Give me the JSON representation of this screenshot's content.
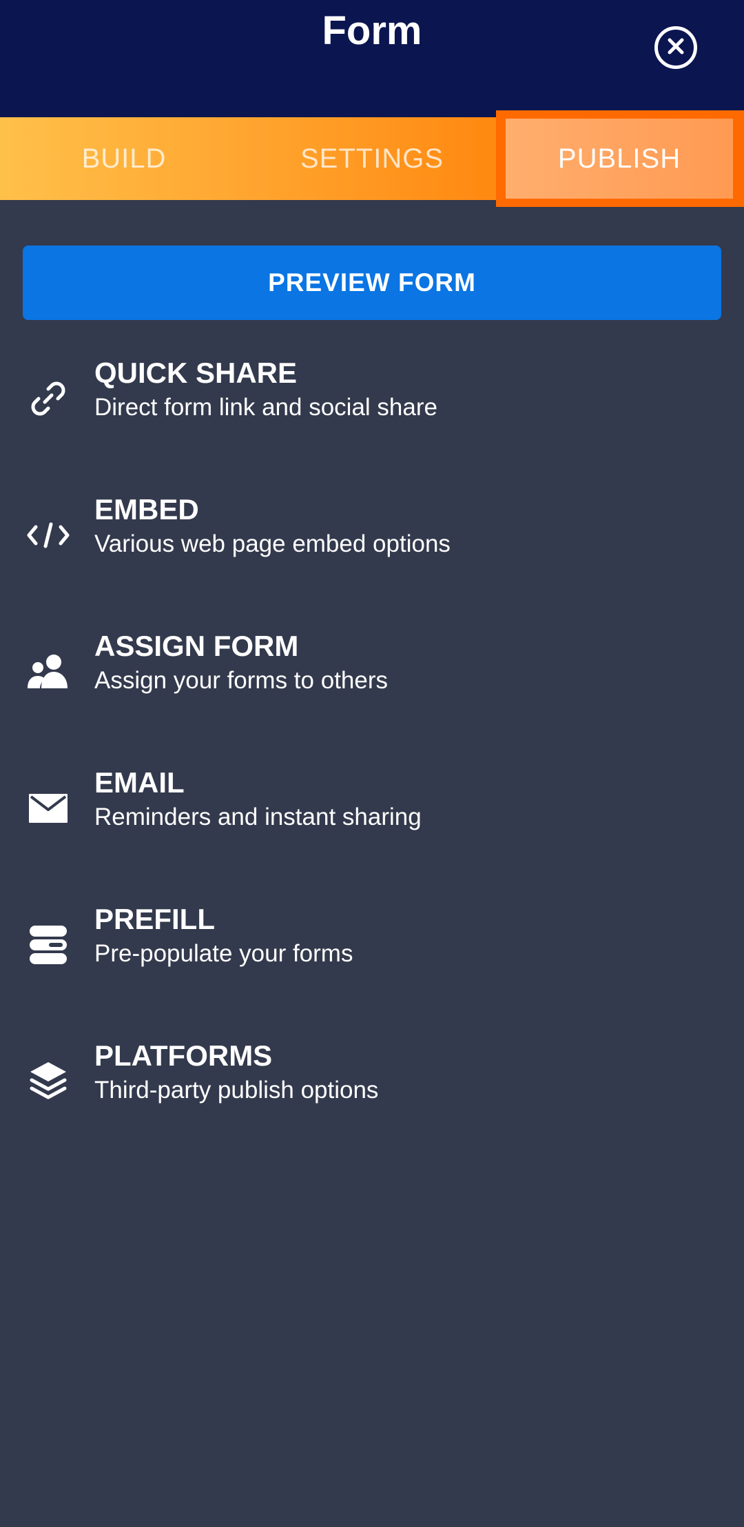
{
  "header": {
    "title": "Form",
    "close_icon": "close-circle-icon"
  },
  "tabs": [
    {
      "label": "BUILD",
      "active": false
    },
    {
      "label": "SETTINGS",
      "active": false
    },
    {
      "label": "PUBLISH",
      "active": true
    }
  ],
  "preview_button": {
    "label": "PREVIEW FORM"
  },
  "items": [
    {
      "title": "QUICK SHARE",
      "subtitle": "Direct form link and social share",
      "icon": "link-icon"
    },
    {
      "title": "EMBED",
      "subtitle": "Various web page embed options",
      "icon": "code-icon"
    },
    {
      "title": "ASSIGN FORM",
      "subtitle": "Assign your forms to others",
      "icon": "users-icon"
    },
    {
      "title": "EMAIL",
      "subtitle": "Reminders and instant sharing",
      "icon": "envelope-icon"
    },
    {
      "title": "PREFILL",
      "subtitle": "Pre-populate your forms",
      "icon": "prefill-icon"
    },
    {
      "title": "PLATFORMS",
      "subtitle": "Third-party publish options",
      "icon": "layers-icon"
    }
  ],
  "colors": {
    "header_bg": "#0b1550",
    "page_bg": "#343a4d",
    "accent_orange": "#ff6a00",
    "button_blue": "#0a75e3"
  }
}
